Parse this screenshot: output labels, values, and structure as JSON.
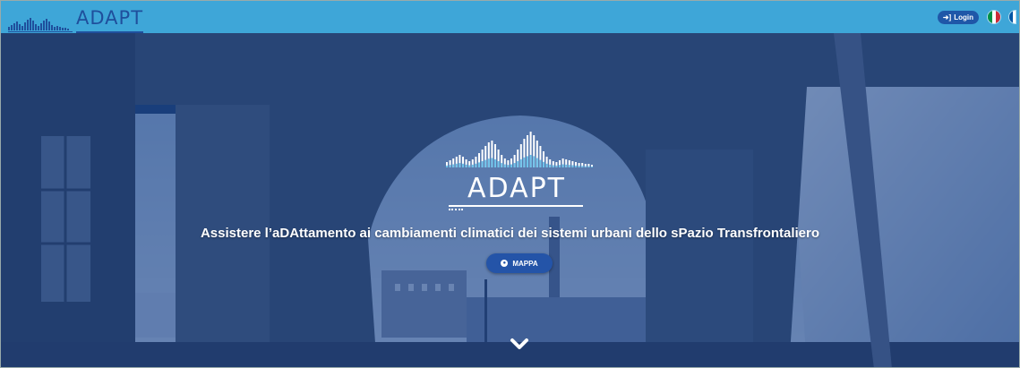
{
  "header": {
    "brand": "ADAPT",
    "login_label": "Login",
    "languages": [
      {
        "code": "it",
        "colors": [
          "#009246",
          "#ffffff",
          "#ce2b37"
        ]
      },
      {
        "code": "fr",
        "colors": [
          "#0055a4",
          "#ffffff",
          "#ef4135"
        ]
      }
    ]
  },
  "hero": {
    "logo_text": "ADAPT",
    "tagline": "Assistere l’aDAttamento ai cambiamenti climatici dei sistemi urbani dello sPazio Transfrontaliero",
    "map_button_label": "MAPPA",
    "scroll_icon": "chevron-down-icon"
  },
  "colors": {
    "topbar": "#3ea6d8",
    "brand_blue": "#1f4f9c",
    "button_blue": "#2454a8",
    "overlay": "#19418780"
  }
}
